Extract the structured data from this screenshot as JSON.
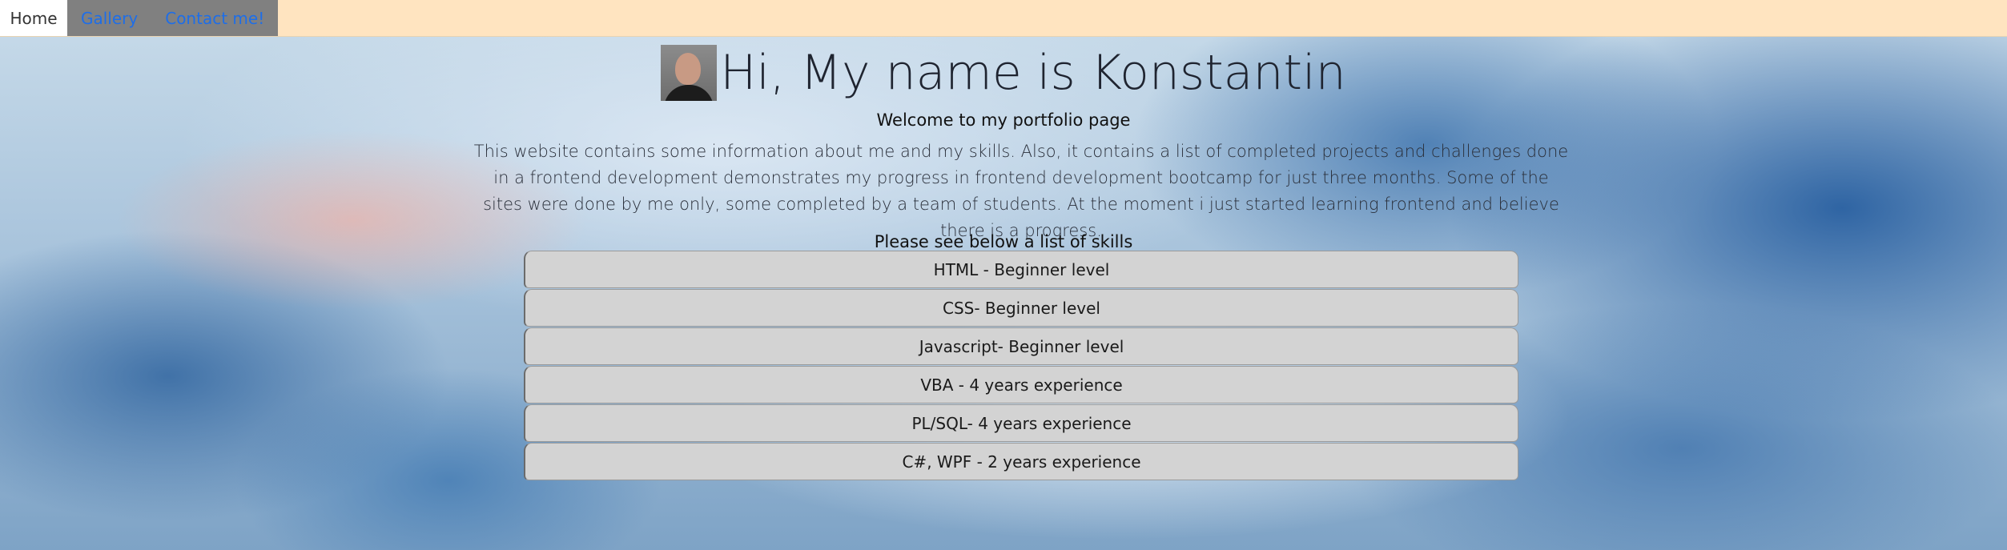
{
  "nav": {
    "items": [
      {
        "label": "Home",
        "active": true
      },
      {
        "label": "Gallery",
        "active": false
      },
      {
        "label": "Contact me!",
        "active": false
      }
    ]
  },
  "header": {
    "title": "Hi, My name is Konstantin",
    "subtitle": "Welcome to my portfolio page"
  },
  "intro": {
    "text": "This website contains some information about me and my skills. Also, it contains a list of completed projects and challenges done in a frontend development demonstrates my progress in frontend development bootcamp for just three months. Some of the sites were done by me only, some completed by a team of students. At the moment i just started learning frontend and believe there is a progress."
  },
  "skills": {
    "heading": "Please see below a list of skills",
    "items": [
      "HTML - Beginner level",
      "CSS- Beginner level",
      "Javascript- Beginner level",
      "VBA - 4 years experience",
      "PL/SQL- 4 years experience",
      "C#, WPF - 2 years experience"
    ]
  },
  "colors": {
    "nav_background": "#ffe4c0",
    "nav_inactive": "#808080",
    "link": "#1e6ee8",
    "skill_background": "#d3d3d3"
  }
}
